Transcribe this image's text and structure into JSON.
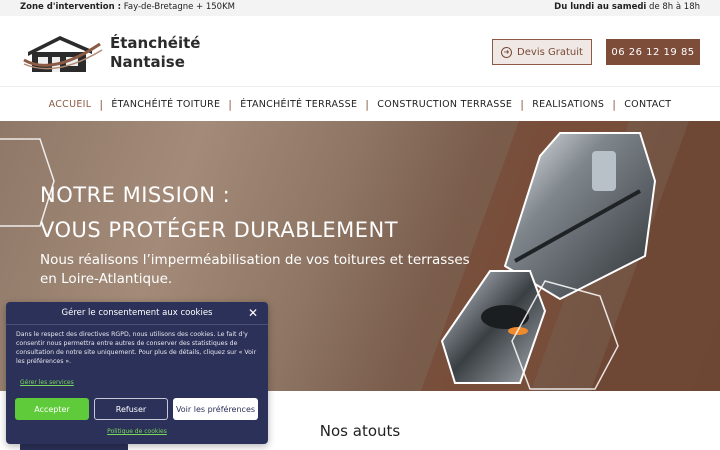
{
  "topbar": {
    "zone_label": "Zone d'intervention :",
    "zone_value": "Fay-de-Bretagne + 150KM",
    "hours_label": "Du lundi au samedi",
    "hours_value": "de 8h à 18h"
  },
  "header": {
    "logo_line1": "Étanchéité",
    "logo_line2": "Nantaise",
    "devis_label": "Devis Gratuit",
    "devis_icon": "arrow-right-circle-icon",
    "phone": "06 26 12 19 85"
  },
  "nav": {
    "items": [
      {
        "label": "ACCUEIL",
        "active": true
      },
      {
        "label": "ÉTANCHÉITÉ TOITURE"
      },
      {
        "label": "ÉTANCHÉITÉ TERRASSE"
      },
      {
        "label": "CONSTRUCTION TERRASSE"
      },
      {
        "label": "REALISATIONS"
      },
      {
        "label": "CONTACT"
      }
    ]
  },
  "hero": {
    "title_line1": "NOTRE MISSION :",
    "title_line2": "VOUS PROTÉGER DURABLEMENT",
    "subtitle": "Nous réalisons l’imperméabilisation de vos toitures et terrasses en Loire-Atlantique."
  },
  "section": {
    "atouts_title": "Nos atouts"
  },
  "cookie": {
    "title": "Gérer le consentement aux cookies",
    "close_icon": "close-icon",
    "body": "Dans le respect des directives RGPD, nous utilisons des cookies. Le fait d'y consentir nous permettra entre autres de conserver des statistiques de consultation de notre site uniquement. Pour plus de détails, cliquez sur « Voir les préférences ».",
    "manage_services": "Gérer les services",
    "accept": "Accepter",
    "refuse": "Refuser",
    "preferences": "Voir les préférences",
    "policy": "Politique de cookies"
  },
  "colors": {
    "brand_brown": "#7d4d39",
    "modal_navy": "#2c3159",
    "accept_green": "#5fcb3a"
  }
}
